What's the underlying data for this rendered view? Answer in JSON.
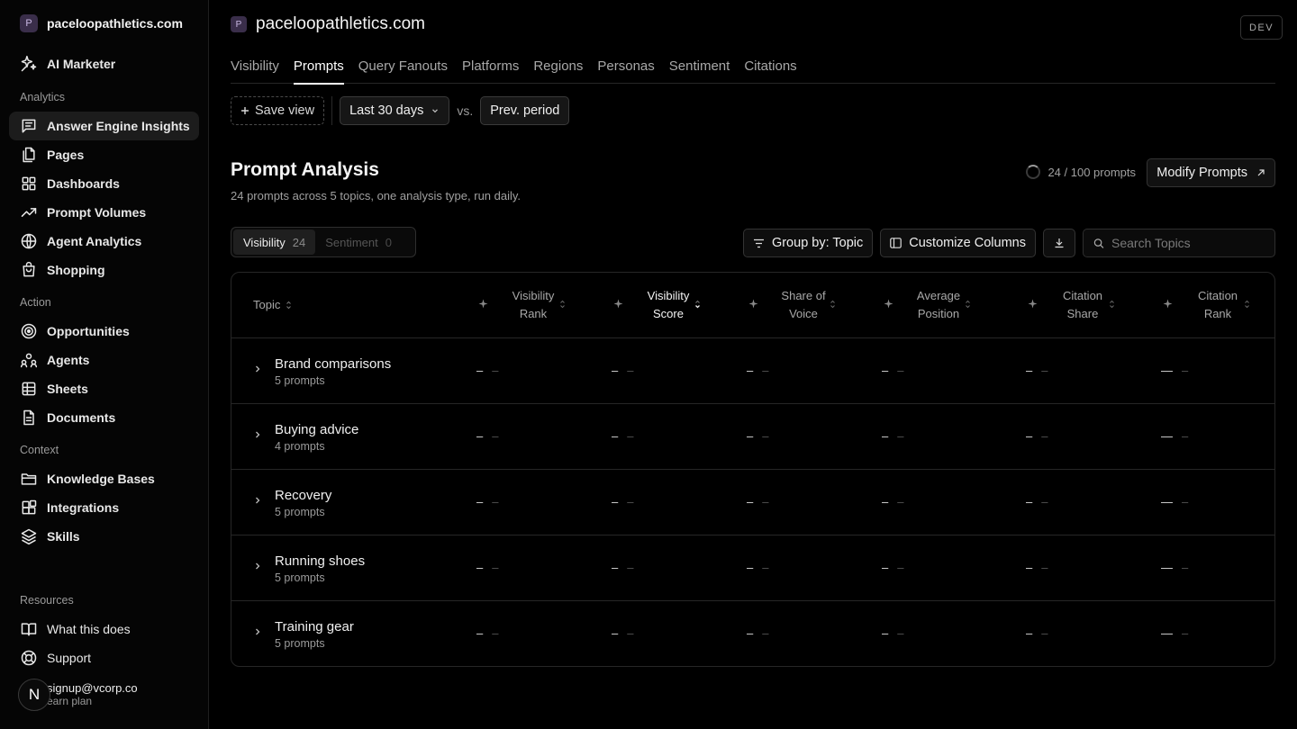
{
  "workspace": {
    "badge": "P",
    "name": "paceloopathletics.com"
  },
  "sidebar": {
    "top_item": {
      "label": "AI Marketer"
    },
    "sections": {
      "analytics": "Analytics",
      "action": "Action",
      "context": "Context",
      "resources": "Resources"
    },
    "analytics_items": [
      {
        "label": "Answer Engine Insights",
        "icon": "message-square-icon",
        "active": true
      },
      {
        "label": "Pages",
        "icon": "files-icon"
      },
      {
        "label": "Dashboards",
        "icon": "layout-grid-icon"
      },
      {
        "label": "Prompt Volumes",
        "icon": "trending-up-icon"
      },
      {
        "label": "Agent Analytics",
        "icon": "globe-icon"
      },
      {
        "label": "Shopping",
        "icon": "shopping-bag-icon"
      }
    ],
    "action_items": [
      {
        "label": "Opportunities",
        "icon": "target-icon"
      },
      {
        "label": "Agents",
        "icon": "users-icon"
      },
      {
        "label": "Sheets",
        "icon": "table-icon"
      },
      {
        "label": "Documents",
        "icon": "document-icon"
      }
    ],
    "context_items": [
      {
        "label": "Knowledge Bases",
        "icon": "folder-icon"
      },
      {
        "label": "Integrations",
        "icon": "puzzle-icon"
      },
      {
        "label": "Skills",
        "icon": "layers-icon"
      }
    ],
    "resources_items": [
      {
        "label": "What this does",
        "icon": "book-icon"
      },
      {
        "label": "Support",
        "icon": "lifebuoy-icon"
      }
    ],
    "user": {
      "initial": "N",
      "email": "signup@vcorp.co",
      "plan": "earn plan"
    }
  },
  "header": {
    "badge": "P",
    "title": "paceloopathletics.com",
    "env_badge": "DEV",
    "tabs": [
      "Visibility",
      "Prompts",
      "Query Fanouts",
      "Platforms",
      "Regions",
      "Personas",
      "Sentiment",
      "Citations"
    ],
    "active_tab": "Prompts"
  },
  "toolbar": {
    "save_view": "Save view",
    "date_range": "Last 30 days",
    "vs": "vs.",
    "compare": "Prev. period"
  },
  "analysis": {
    "title": "Prompt Analysis",
    "subtitle": "24 prompts across 5 topics, one analysis type, run daily.",
    "quota": "24 / 100 prompts",
    "modify_button": "Modify Prompts"
  },
  "segments": [
    {
      "label": "Visibility",
      "count": "24",
      "active": true
    },
    {
      "label": "Sentiment",
      "count": "0",
      "active": false
    }
  ],
  "tools": {
    "group_by": "Group by: Topic",
    "customize": "Customize Columns",
    "search_placeholder": "Search Topics"
  },
  "table": {
    "topic_header": "Topic",
    "columns": [
      {
        "line1": "Visibility",
        "line2": "Rank",
        "sorted": false
      },
      {
        "line1": "Visibility",
        "line2": "Score",
        "sorted": true
      },
      {
        "line1": "Share of",
        "line2": "Voice",
        "sorted": false
      },
      {
        "line1": "Average",
        "line2": "Position",
        "sorted": false
      },
      {
        "line1": "Citation",
        "line2": "Share",
        "sorted": false
      },
      {
        "line1": "Citation",
        "line2": "Rank",
        "sorted": false
      }
    ],
    "rows": [
      {
        "topic": "Brand comparisons",
        "count": "5 prompts",
        "values": [
          "–",
          "–",
          "–",
          "–",
          "–",
          "—"
        ],
        "deltas": [
          "–",
          "–",
          "–",
          "–",
          "–",
          "–"
        ]
      },
      {
        "topic": "Buying advice",
        "count": "4 prompts",
        "values": [
          "–",
          "–",
          "–",
          "–",
          "–",
          "—"
        ],
        "deltas": [
          "–",
          "–",
          "–",
          "–",
          "–",
          "–"
        ]
      },
      {
        "topic": "Recovery",
        "count": "5 prompts",
        "values": [
          "–",
          "–",
          "–",
          "–",
          "–",
          "—"
        ],
        "deltas": [
          "–",
          "–",
          "–",
          "–",
          "–",
          "–"
        ]
      },
      {
        "topic": "Running shoes",
        "count": "5 prompts",
        "values": [
          "–",
          "–",
          "–",
          "–",
          "–",
          "—"
        ],
        "deltas": [
          "–",
          "–",
          "–",
          "–",
          "–",
          "–"
        ]
      },
      {
        "topic": "Training gear",
        "count": "5 prompts",
        "values": [
          "–",
          "–",
          "–",
          "–",
          "–",
          "—"
        ],
        "deltas": [
          "–",
          "–",
          "–",
          "–",
          "–",
          "–"
        ]
      }
    ]
  }
}
